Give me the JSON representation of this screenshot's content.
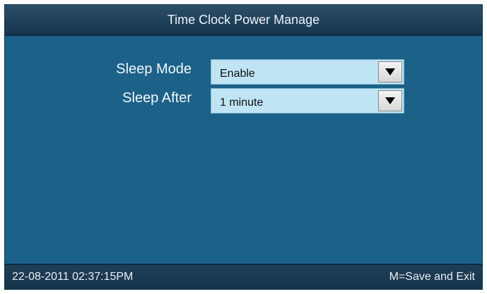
{
  "header": {
    "title": "Time Clock Power Manage"
  },
  "settings": [
    {
      "label": "Sleep Mode",
      "value": "Enable"
    },
    {
      "label": "Sleep After",
      "value": "1 minute"
    }
  ],
  "footer": {
    "datetime": "22-08-2011  02:37:15PM",
    "hint": "M=Save and Exit"
  },
  "icons": {
    "dropdown": "triangle-down-icon"
  },
  "colors": {
    "background": "#1c6188",
    "select_fill": "#bfe4f4",
    "title_bar": "#1e3f58"
  }
}
